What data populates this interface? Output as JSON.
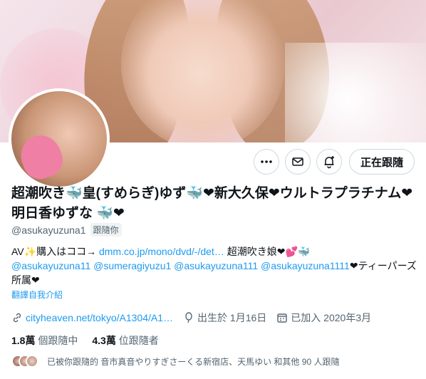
{
  "profile": {
    "name": "超潮吹き🐳皇(すめらぎ)ゆず🐳❤新大久保❤ウルトラプラチナム❤明日香ゆずな 🐳❤",
    "handle": "@asukayuzuna1",
    "follows_you": "跟隨你",
    "bio": {
      "line1_prefix": "AV✨購入はココ→ ",
      "line1_link": "dmm.co.jp/mono/dvd/-/det…",
      "line1_suffix": "  超潮吹き娘❤💕🐳",
      "line2_mentions": "@asukayuzuna11 @sumeragiyuzu1 @asukayuzuna111 @asukayuzuna1111",
      "line2_suffix": "❤ティーパーズ所属❤"
    },
    "translate": "翻譯自我介紹",
    "website": "cityheaven.net/tokyo/A1304/A1…",
    "birthday": "出生於 1月16日",
    "joined": "已加入 2020年3月",
    "following_count": "1.8萬",
    "following_label": "個跟隨中",
    "followers_count": "4.3萬",
    "followers_label": "位跟隨者",
    "followed_by": "已被你跟隨的 音市真音やりすぎさーくる新宿店、天馬ゆい 和其他 90 人跟隨"
  },
  "actions": {
    "following_button": "正在跟隨"
  }
}
